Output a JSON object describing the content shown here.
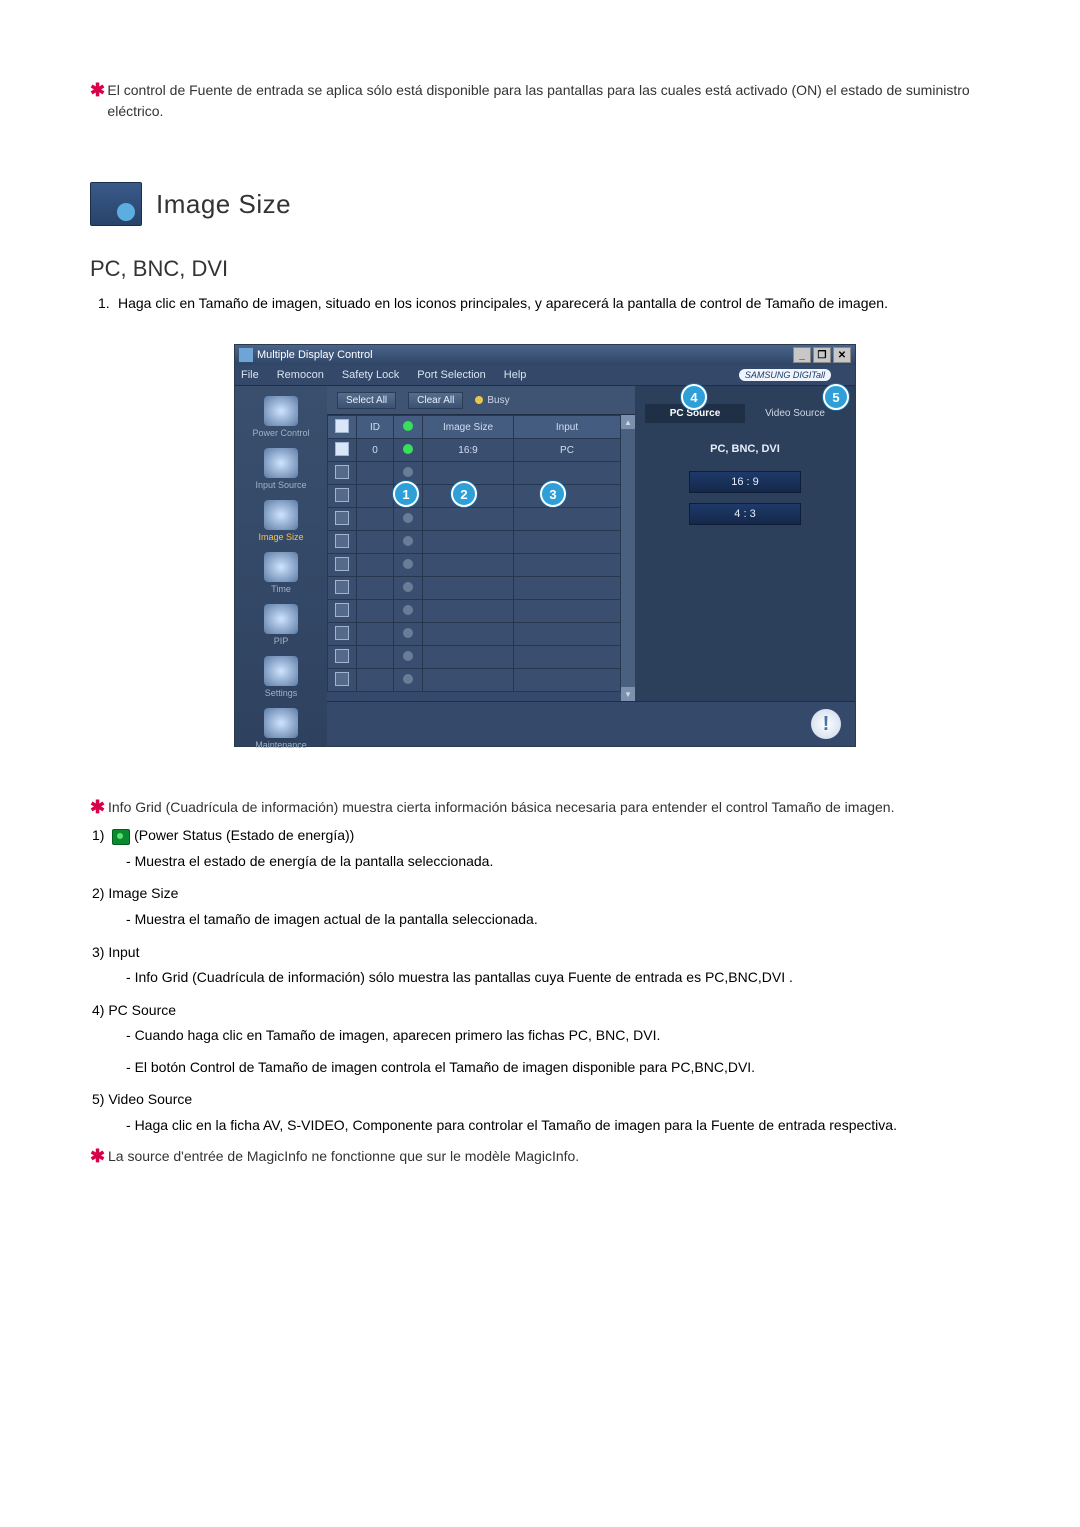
{
  "intro_note": "El control de Fuente de entrada se aplica sólo está disponible para las pantallas para las cuales está activado (ON) el estado de suministro eléctrico.",
  "section_title": "Image Size",
  "subtitle": "PC, BNC, DVI",
  "step1": "Haga clic en Tamaño de imagen, situado en los iconos principales, y aparecerá la pantalla de control de Tamaño de imagen.",
  "mdc": {
    "title": "Multiple Display Control",
    "menus": [
      "File",
      "Remocon",
      "Safety Lock",
      "Port Selection",
      "Help"
    ],
    "brand": "SAMSUNG DIGITall",
    "sidebar": [
      {
        "label": "Power Control"
      },
      {
        "label": "Input Source"
      },
      {
        "label": "Image Size",
        "active": true
      },
      {
        "label": "Time"
      },
      {
        "label": "PIP"
      },
      {
        "label": "Settings"
      },
      {
        "label": "Maintenance"
      }
    ],
    "buttons": {
      "select_all": "Select All",
      "clear_all": "Clear All",
      "busy": "Busy"
    },
    "grid": {
      "headers": {
        "chk": "",
        "id": "ID",
        "led": "",
        "size": "Image Size",
        "input": "Input"
      },
      "rows": [
        {
          "chk": true,
          "id": "0",
          "led": true,
          "size": "16:9",
          "input": "PC"
        },
        {
          "chk": false,
          "id": "",
          "led": false,
          "size": "",
          "input": ""
        },
        {
          "chk": false,
          "id": "",
          "led": false,
          "size": "",
          "input": ""
        },
        {
          "chk": false,
          "id": "",
          "led": false,
          "size": "",
          "input": ""
        },
        {
          "chk": false,
          "id": "",
          "led": false,
          "size": "",
          "input": ""
        },
        {
          "chk": false,
          "id": "",
          "led": false,
          "size": "",
          "input": ""
        },
        {
          "chk": false,
          "id": "",
          "led": false,
          "size": "",
          "input": ""
        },
        {
          "chk": false,
          "id": "",
          "led": false,
          "size": "",
          "input": ""
        },
        {
          "chk": false,
          "id": "",
          "led": false,
          "size": "",
          "input": ""
        },
        {
          "chk": false,
          "id": "",
          "led": false,
          "size": "",
          "input": ""
        },
        {
          "chk": false,
          "id": "",
          "led": false,
          "size": "",
          "input": ""
        }
      ]
    },
    "right": {
      "tab_pc": "PC Source",
      "tab_video": "Video Source",
      "panel_title": "PC, BNC, DVI",
      "opt1": "16 : 9",
      "opt2": "4 : 3"
    },
    "callouts": {
      "c1": "1",
      "c2": "2",
      "c3": "3",
      "c4": "4",
      "c5": "5"
    }
  },
  "desc": {
    "info_grid": "Info Grid (Cuadrícula de información) muestra cierta información básica necesaria para entender el control Tamaño de imagen.",
    "i1_label": "1)",
    "i1_name": " (Power Status (Estado de energía))",
    "i1_sub": "Muestra el estado de energía de la pantalla seleccionada.",
    "i2_label": "2)  Image Size",
    "i2_sub": "Muestra el tamaño de imagen actual de la pantalla seleccionada.",
    "i3_label": "3)  Input",
    "i3_sub": "Info Grid (Cuadrícula de información) sólo muestra las pantallas cuya Fuente de entrada es PC,BNC,DVI .",
    "i4_label": "4)  PC Source",
    "i4_sub1": "Cuando haga clic en Tamaño de imagen, aparecen primero las fichas PC, BNC, DVI.",
    "i4_sub2": "El botón Control de Tamaño de imagen controla el Tamaño de imagen disponible para PC,BNC,DVI.",
    "i5_label": "5)  Video Source",
    "i5_sub": "Haga clic en la ficha AV, S-VIDEO, Componente para controlar el Tamaño de imagen para la Fuente de entrada respectiva.",
    "final_note": "La source d'entrée de MagicInfo ne fonctionne que sur le modèle MagicInfo."
  }
}
